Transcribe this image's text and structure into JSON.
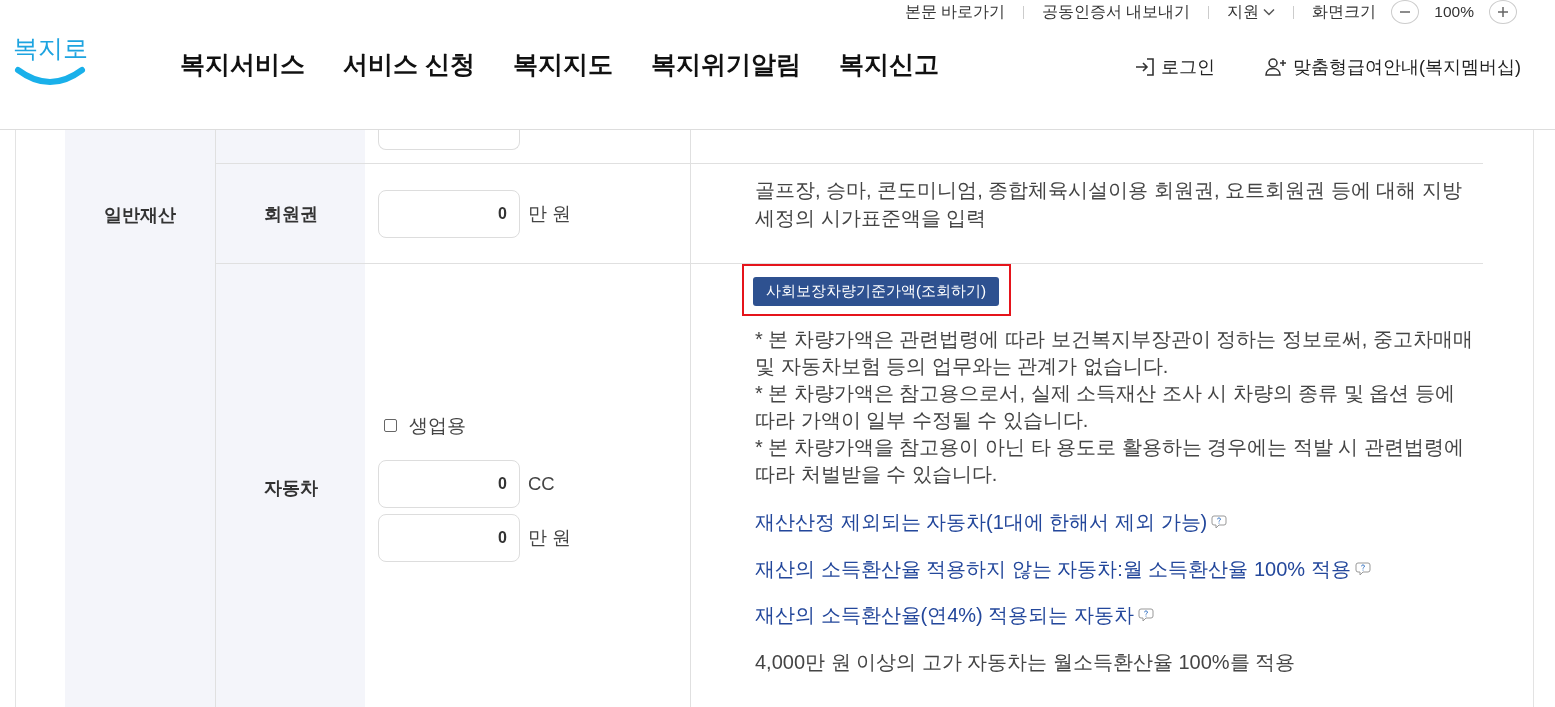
{
  "utility_bar": {
    "links": [
      "본문 바로가기",
      "공동인증서 내보내기"
    ],
    "language": {
      "label": "지원"
    },
    "zoom": {
      "label": "화면크기",
      "value": "100%"
    }
  },
  "header": {
    "logo": "복지로",
    "nav": [
      "복지서비스",
      "서비스 신청",
      "복지지도",
      "복지위기알림",
      "복지신고"
    ],
    "actions": [
      {
        "kind": "login",
        "label": "로그인"
      },
      {
        "kind": "membership",
        "label": "맞춤형급여안내(복지멤버십)"
      }
    ]
  },
  "table": {
    "group_label": "일반재산",
    "rows": [
      {
        "kind": "clipped"
      },
      {
        "kind": "amount",
        "label": "회원권",
        "fields": [
          {
            "value": "0",
            "unit": "만 원"
          }
        ],
        "description": "골프장, 승마, 콘도미니엄, 종합체육시설이용 회원권, 요트회원권 등에 대해 지방세정의 시가표준액을 입력"
      },
      {
        "kind": "vehicle",
        "label": "자동차",
        "checkbox": {
          "label": "생업용",
          "checked": false
        },
        "fields": [
          {
            "value": "0",
            "unit": "CC"
          },
          {
            "value": "0",
            "unit": "만 원"
          }
        ],
        "button": {
          "label": "사회보장차량기준가액(조회하기)",
          "highlighted": true
        },
        "notes": [
          "* 본 차량가액은 관련법령에 따라 보건복지부장관이 정하는 정보로써, 중고차매매 및 자동차보험 등의 업무와는 관계가 없습니다.",
          "* 본 차량가액은 참고용으로서, 실제 소득재산 조사 시 차량의 종류 및 옵션 등에 따라 가액이 일부 수정될 수 있습니다.",
          "* 본 차량가액을 참고용이 아닌 타 용도로 활용하는 경우에는 적발 시 관련법령에 따라 처벌받을 수 있습니다."
        ],
        "links": [
          "재산산정 제외되는 자동차(1대에 한해서 제외 가능)",
          "재산의 소득환산율 적용하지 않는 자동차:월 소득환산율 100% 적용",
          "재산의 소득환산율(연4%) 적용되는 자동차"
        ],
        "footnote": "4,000만 원 이상의 고가 자동차는 월소득환산율 100%를 적용"
      }
    ]
  }
}
